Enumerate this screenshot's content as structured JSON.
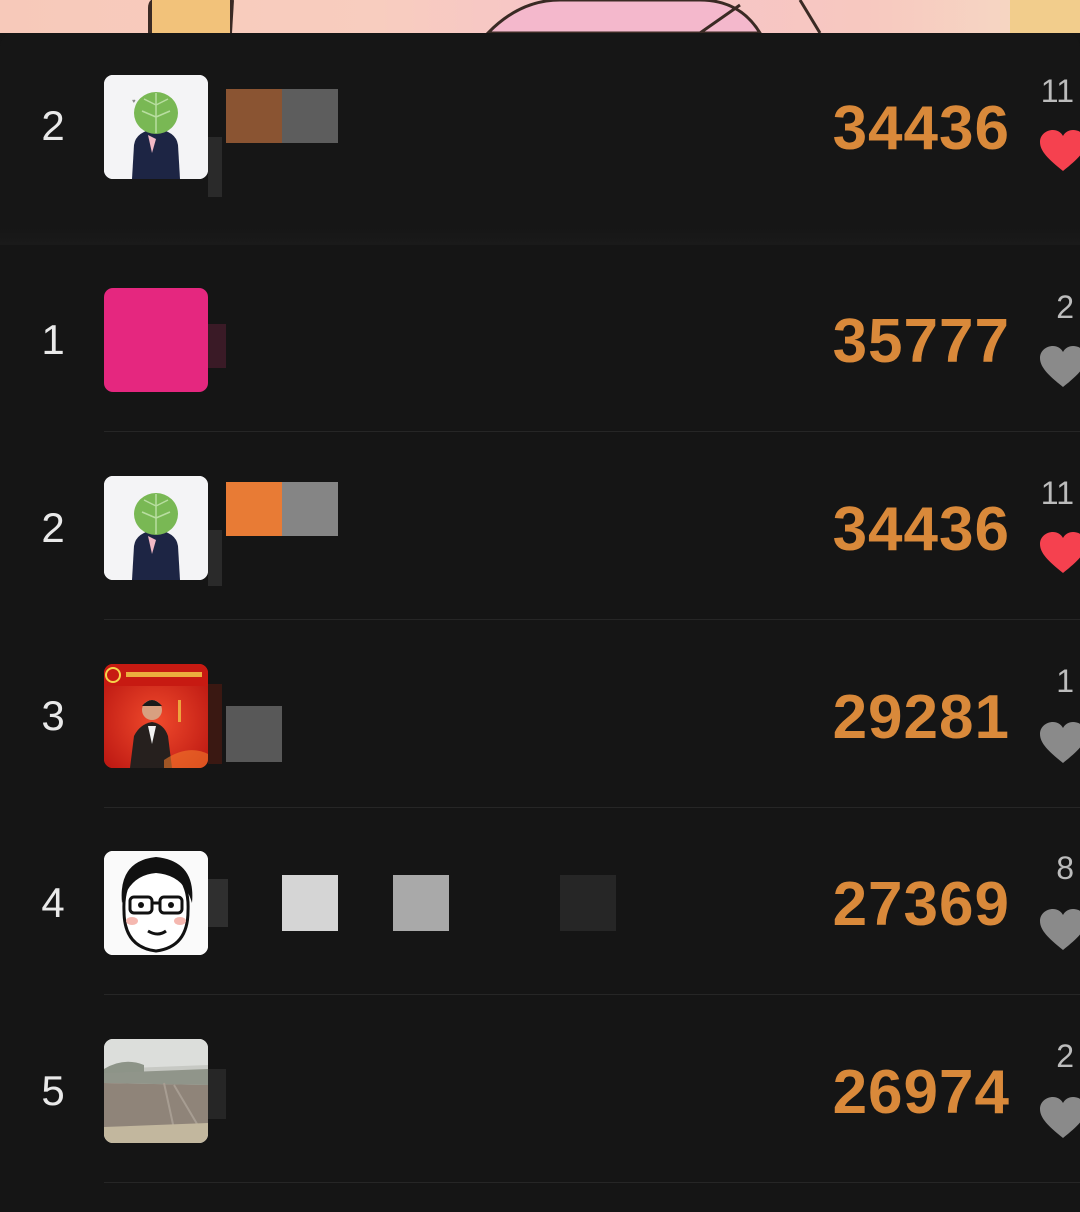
{
  "my_rank": {
    "rank": "2",
    "score": "34436",
    "likes": "11",
    "liked": true
  },
  "leaderboard": [
    {
      "rank": "1",
      "score": "35777",
      "likes": "2",
      "liked": false
    },
    {
      "rank": "2",
      "score": "34436",
      "likes": "11",
      "liked": true
    },
    {
      "rank": "3",
      "score": "29281",
      "likes": "1",
      "liked": false
    },
    {
      "rank": "4",
      "score": "27369",
      "likes": "8",
      "liked": false
    },
    {
      "rank": "5",
      "score": "26974",
      "likes": "2",
      "liked": false
    }
  ],
  "colors": {
    "score": "#d9893a",
    "heart_liked": "#f5414f",
    "heart_default": "#8a8a8a",
    "background": "#151515"
  },
  "icons": {
    "heart": "heart-icon"
  }
}
